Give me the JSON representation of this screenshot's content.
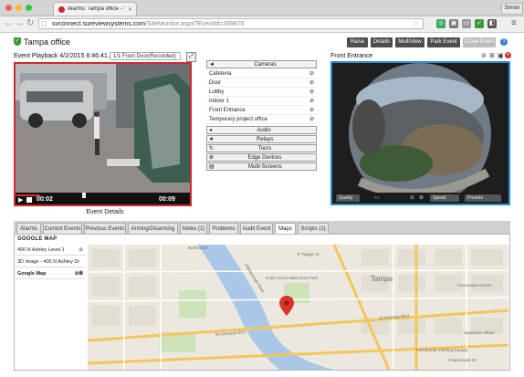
{
  "browser": {
    "tab_title": "Alarms: Tampa office - Sur",
    "url_host": "svconnect.sureviewsystems.com",
    "url_path": "/SiteMonitor.aspx?EventId=339876",
    "user": "Simon"
  },
  "header": {
    "site_name": "Tampa office",
    "buttons": [
      "Raise",
      "Details",
      "MultiView",
      "Park Event",
      "Close Event"
    ]
  },
  "playback": {
    "label": "Event Playback 4/2/2015 8:46:41 AM",
    "camera_select": "1/1 Front Door(Recorded)",
    "time_current": "00:02",
    "time_total": "00:09",
    "progress": 0.14,
    "event_details_label": "Event Details"
  },
  "cameras_panel": {
    "title": "Cameras",
    "cameras": [
      "Cafeteria",
      "Door",
      "Lobby",
      "Indoor 1",
      "Front Entrance",
      "Temporary project office"
    ],
    "sections": [
      "Audio",
      "Relays",
      "Tours",
      "Edge Devices",
      "Multi-Screens"
    ]
  },
  "live": {
    "label": "Front Entrance",
    "quality_label": "Quality",
    "speed_label": "Speed",
    "presets_label": "Presets"
  },
  "tabs": [
    "Alarms",
    "Current Events",
    "Previous Events",
    "Arming/Disarming",
    "Notes (2)",
    "Problems",
    "Audit Event",
    "Maps",
    "Scripts (1)"
  ],
  "active_tab": "Maps",
  "map_panel": {
    "title": "GOOGLE MAP",
    "items": [
      "400 N Ashley Level 1",
      "3D image - 400 N Ashley Dr",
      "Google Map"
    ]
  },
  "map_labels": {
    "city": "Tampa",
    "river": "Hillsborough River",
    "street_1": "North Blvd",
    "street_2": "W Kennedy Blvd",
    "street_3": "E Kennedy Blvd",
    "street_4": "E Twiggs St",
    "street_5": "Channelside Dr",
    "poi_1": "Convention Center",
    "poi_2": "Fort Brooke Parking Garage",
    "poi_3": "Sparkman Wharf",
    "poi_4": "Curtis Hixon Waterfront Park"
  },
  "colors": {
    "accent_red": "#d42a2a",
    "live_border": "#2b8bd6",
    "button_dark": "#4e4e4e",
    "status_green": "#3a9a3a"
  }
}
